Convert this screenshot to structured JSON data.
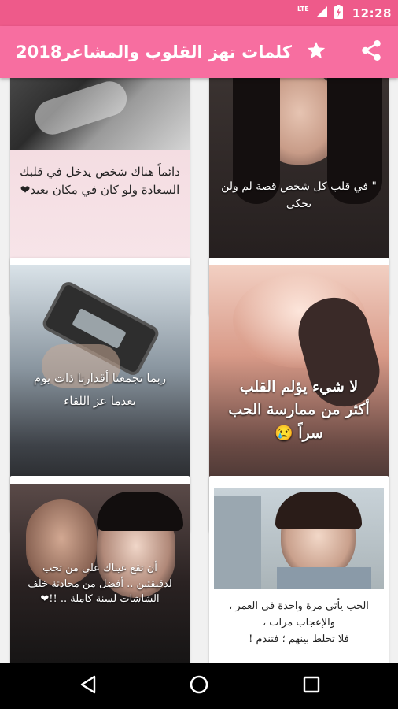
{
  "status_bar": {
    "time": "12:28",
    "network_label": "LTE",
    "icons": [
      "network-lte-icon",
      "signal-icon",
      "battery-icon"
    ]
  },
  "app_bar": {
    "title": "كلمات تهز القلوب والمشاعر2018",
    "actions": [
      "star-icon",
      "share-icon"
    ],
    "color": "#f76ea0"
  },
  "cards": [
    {
      "caption": [
        "دائماً هناك شخص يدخل في قلبك",
        "السعادة ولو كان في مكان بعيد❤"
      ]
    },
    {
      "caption": [
        "\" في قلب كل شخص قصة لم ولن تحكى"
      ]
    },
    {
      "caption": [
        "ربما تجمعنا أقدارنا ذات يوم",
        "بعدما عز اللقاء"
      ]
    },
    {
      "caption": [
        "لا شيء يؤلم القلب",
        "أكثر من ممارسة الحب سراً 😢"
      ]
    },
    {
      "caption": [
        "أن تقع عيناك على من تحب",
        "لدقيقتين .. أفضل من محادثة خلف",
        "الشاشات لسنة كاملة .. !!❤"
      ]
    },
    {
      "caption": [
        "الحب يأتي مرة واحدة في العمر ،",
        "والإعجاب مرات ،",
        "فلا تخلط بينهم ؛ فتندم !"
      ]
    }
  ],
  "nav_bar": {
    "buttons": [
      "back-icon",
      "home-icon",
      "recents-icon"
    ]
  }
}
